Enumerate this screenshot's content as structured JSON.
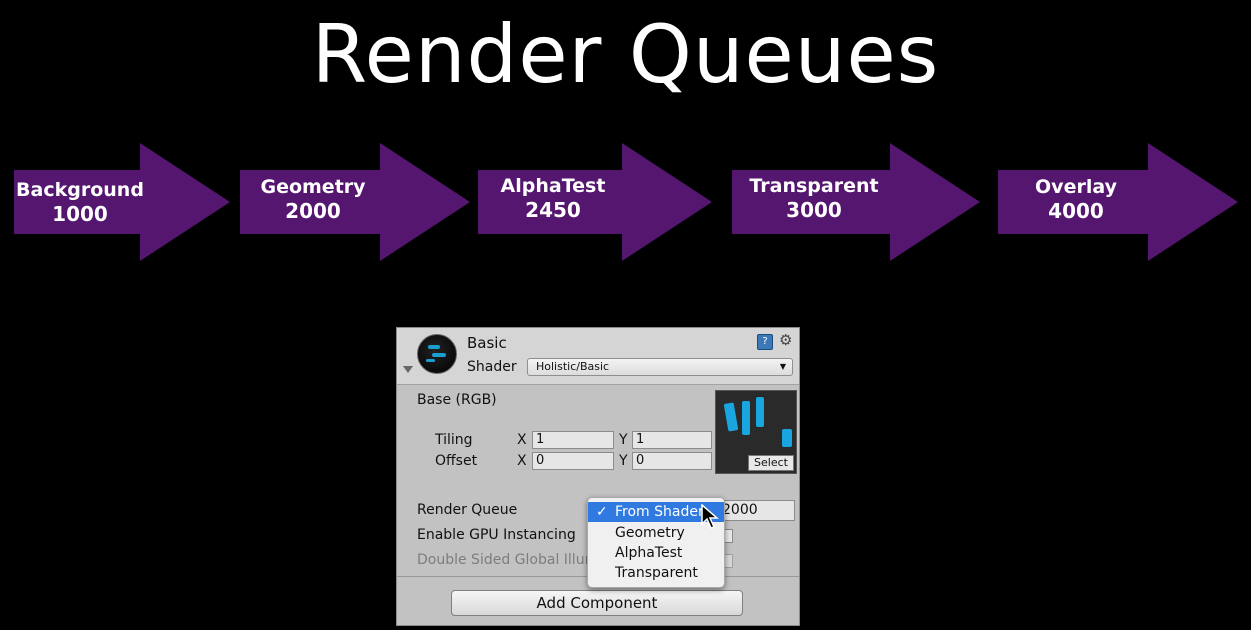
{
  "title": "Render Queues",
  "queues": [
    {
      "name": "Background",
      "value": "1000"
    },
    {
      "name": "Geometry",
      "value": "2000"
    },
    {
      "name": "AlphaTest",
      "value": "2450"
    },
    {
      "name": "Transparent",
      "value": "3000"
    },
    {
      "name": "Overlay",
      "value": "4000"
    }
  ],
  "colors": {
    "arrow": "#54166f",
    "menu_highlight": "#2f79e0"
  },
  "inspector": {
    "material_name": "Basic",
    "shader_label": "Shader",
    "shader_value": "Holistic/Basic",
    "base_label": "Base (RGB)",
    "tiling_label": "Tiling",
    "offset_label": "Offset",
    "x_label": "X",
    "y_label": "Y",
    "tiling_x": "1",
    "tiling_y": "1",
    "offset_x": "0",
    "offset_y": "0",
    "texture_select": "Select",
    "render_queue_label": "Render Queue",
    "render_queue_value": "2000",
    "gpu_instancing_label": "Enable GPU Instancing",
    "double_sided_label": "Double Sided Global Illum",
    "add_component": "Add Component",
    "help_icon": "?",
    "gear_icon": "⚙"
  },
  "render_queue_menu": {
    "options": [
      "From Shader",
      "Geometry",
      "AlphaTest",
      "Transparent"
    ],
    "selected": "From Shader"
  }
}
